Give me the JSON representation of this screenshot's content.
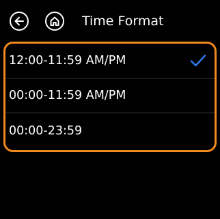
{
  "header": {
    "title": "Time Format",
    "back_icon": "arrow-left-icon",
    "home_icon": "home-icon"
  },
  "options": [
    {
      "label": "12:00-11:59 AM/PM",
      "selected": true
    },
    {
      "label": "00:00-11:59 AM/PM",
      "selected": false
    },
    {
      "label": "00:00-23:59",
      "selected": false
    }
  ],
  "colors": {
    "background": "#000000",
    "highlight_border": "#f08a1e",
    "checkmark": "#2f7df0",
    "divider": "#3a3a3a",
    "text": "#ffffff"
  }
}
